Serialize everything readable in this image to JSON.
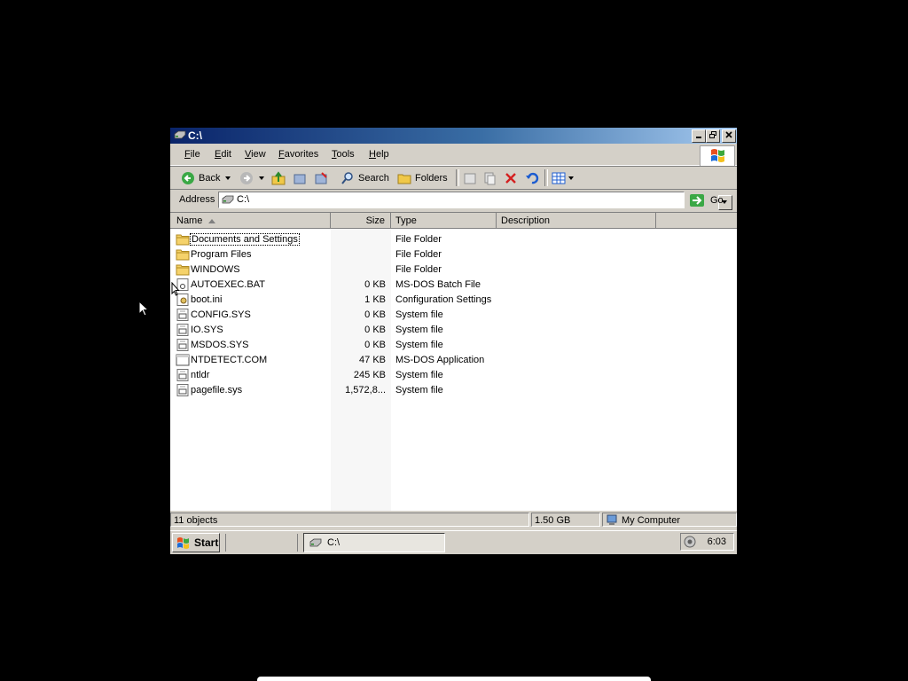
{
  "window": {
    "title": "C:\\"
  },
  "menu": [
    {
      "label": "File",
      "ul": "F",
      "rest": "ile"
    },
    {
      "label": "Edit",
      "ul": "E",
      "rest": "dit"
    },
    {
      "label": "View",
      "ul": "V",
      "rest": "iew"
    },
    {
      "label": "Favorites",
      "ul": "F",
      "rest": "avorites",
      "prefix": ""
    },
    {
      "label": "Tools",
      "ul": "T",
      "rest": "ools"
    },
    {
      "label": "Help",
      "ul": "H",
      "rest": "elp"
    }
  ],
  "toolbar": {
    "back": "Back",
    "search": "Search",
    "folders": "Folders"
  },
  "address": {
    "label": "Address",
    "value": "C:\\",
    "go": "Go"
  },
  "columns": {
    "name": "Name",
    "size": "Size",
    "type": "Type",
    "description": "Description"
  },
  "files": [
    {
      "name": "Documents and Settings",
      "size": "",
      "type": "File Folder",
      "icon": "folder-icon"
    },
    {
      "name": "Program Files",
      "size": "",
      "type": "File Folder",
      "icon": "folder-icon"
    },
    {
      "name": "WINDOWS",
      "size": "",
      "type": "File Folder",
      "icon": "folder-icon"
    },
    {
      "name": "AUTOEXEC.BAT",
      "size": "0 KB",
      "type": "MS-DOS Batch File",
      "icon": "batch-file-icon"
    },
    {
      "name": "boot.ini",
      "size": "1 KB",
      "type": "Configuration Settings",
      "icon": "settings-file-icon"
    },
    {
      "name": "CONFIG.SYS",
      "size": "0 KB",
      "type": "System file",
      "icon": "system-file-icon"
    },
    {
      "name": "IO.SYS",
      "size": "0 KB",
      "type": "System file",
      "icon": "system-file-icon"
    },
    {
      "name": "MSDOS.SYS",
      "size": "0 KB",
      "type": "System file",
      "icon": "system-file-icon"
    },
    {
      "name": "NTDETECT.COM",
      "size": "47 KB",
      "type": "MS-DOS Application",
      "icon": "application-icon"
    },
    {
      "name": "ntldr",
      "size": "245 KB",
      "type": "System file",
      "icon": "system-file-icon"
    },
    {
      "name": "pagefile.sys",
      "size": "1,572,8...",
      "type": "System file",
      "icon": "system-file-icon"
    }
  ],
  "status": {
    "objects": "11 objects",
    "size": "1.50 GB",
    "location": "My Computer"
  },
  "taskbar": {
    "start": "Start",
    "task": "C:\\",
    "clock": "6:03"
  },
  "colors": {
    "titlebar_start": "#0a246a",
    "titlebar_end": "#a6caf0",
    "face": "#d4d0c8"
  }
}
